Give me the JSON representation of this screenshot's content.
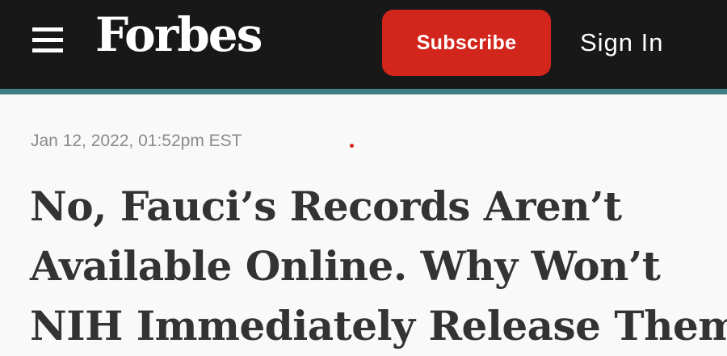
{
  "header": {
    "logo": "Forbes",
    "subscribe_label": "Subscribe",
    "signin_label": "Sign In",
    "menu_icon": "hamburger-menu-icon"
  },
  "article": {
    "timestamp": "Jan 12, 2022, 01:52pm EST",
    "headline_lines": [
      "No, Fauci’s Records Aren’t",
      "Available Online. Why Won’t",
      "NIH Immediately Release Them?"
    ]
  },
  "colors": {
    "header_bg": "#181818",
    "accent_bar": "#3e7f86",
    "subscribe_bg": "#d2261c",
    "page_bg": "#f9f9f9",
    "headline_text": "#333333",
    "timestamp_text": "#8a8a8a"
  }
}
